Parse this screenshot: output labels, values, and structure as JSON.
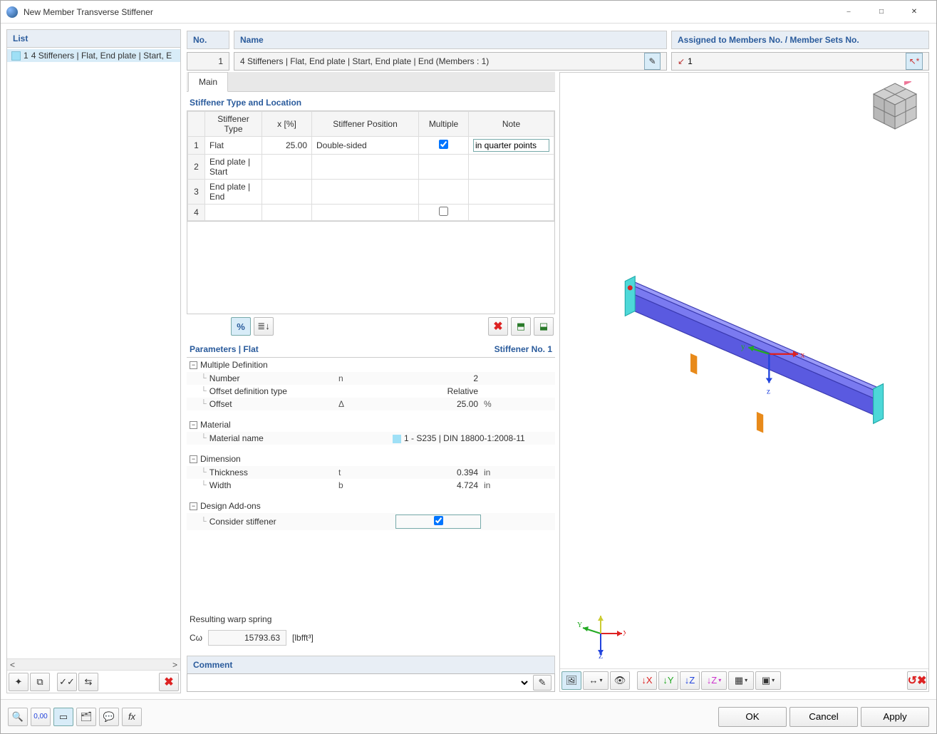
{
  "window": {
    "title": "New Member Transverse Stiffener"
  },
  "left": {
    "header": "List",
    "item_num": "1",
    "item_text": "4 Stiffeners | Flat, End plate | Start, E"
  },
  "top": {
    "no_label": "No.",
    "no_value": "1",
    "name_label": "Name",
    "name_value": "4 Stiffeners | Flat, End plate | Start, End plate | End (Members : 1)",
    "assign_label": "Assigned to Members No. / Member Sets No.",
    "assign_value": "1"
  },
  "tabs": {
    "main": "Main"
  },
  "stiff": {
    "section_title": "Stiffener Type and Location",
    "cols": {
      "type": "Stiffener Type",
      "x": "x [%]",
      "pos": "Stiffener Position",
      "mult": "Multiple",
      "note": "Note"
    },
    "rows": [
      {
        "n": "1",
        "type": "Flat",
        "x": "25.00",
        "pos": "Double-sided",
        "mult": true,
        "note": "in quarter points"
      },
      {
        "n": "2",
        "type": "End plate | Start",
        "x": "",
        "pos": "",
        "mult": null,
        "note": ""
      },
      {
        "n": "3",
        "type": "End plate | End",
        "x": "",
        "pos": "",
        "mult": null,
        "note": ""
      },
      {
        "n": "4",
        "type": "",
        "x": "",
        "pos": "",
        "mult": false,
        "note": ""
      }
    ]
  },
  "params": {
    "title_left": "Parameters | Flat",
    "title_right": "Stiffener No. 1",
    "groups": {
      "mult": {
        "label": "Multiple Definition",
        "number_label": "Number",
        "number_sym": "n",
        "number_val": "2",
        "offtype_label": "Offset definition type",
        "offtype_val": "Relative",
        "offset_label": "Offset",
        "offset_sym": "Δ",
        "offset_val": "25.00",
        "offset_unit": "%"
      },
      "mat": {
        "label": "Material",
        "matname_label": "Material name",
        "matname_val": "1 - S235 | DIN 18800-1:2008-11"
      },
      "dim": {
        "label": "Dimension",
        "thick_label": "Thickness",
        "thick_sym": "t",
        "thick_val": "0.394",
        "thick_unit": "in",
        "width_label": "Width",
        "width_sym": "b",
        "width_val": "4.724",
        "width_unit": "in"
      },
      "design": {
        "label": "Design Add-ons",
        "consider_label": "Consider stiffener",
        "consider_val": true
      }
    }
  },
  "warp": {
    "label": "Resulting warp spring",
    "sym": "Cω",
    "val": "15793.63",
    "unit": "[lbfft³]"
  },
  "comment": {
    "label": "Comment",
    "value": ""
  },
  "viewport": {
    "axes": {
      "x": "X",
      "y": "Y",
      "z": "Z"
    },
    "model_axes": {
      "x": "x",
      "y": "y",
      "z": "z"
    }
  },
  "footer": {
    "ok": "OK",
    "cancel": "Cancel",
    "apply": "Apply"
  },
  "icons": {
    "percent": "%",
    "sort": "≣↓",
    "delete": "✖",
    "excel_in": "⎘",
    "excel_out": "⎙",
    "new": "✦",
    "copy": "⧉",
    "check": "✓✓",
    "swap": "⇆"
  }
}
